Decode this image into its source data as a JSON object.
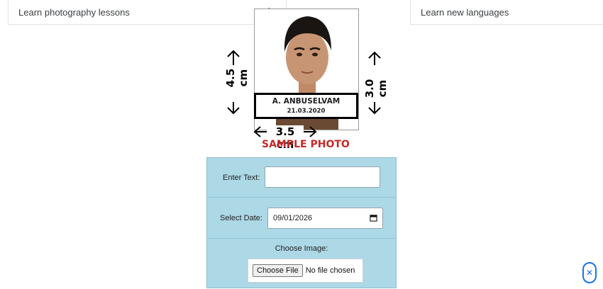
{
  "suggestions": {
    "left_label": "Learn photography lessons",
    "right_label": "Learn new languages"
  },
  "sample": {
    "name": "A. ANBUSELVAM",
    "date": "21.03.2020",
    "height_left": "4.5 cm",
    "height_right": "3.0 cm",
    "width": "3.5 cm",
    "title": "SAMPLE PHOTO",
    "title_color": "#c62828"
  },
  "form": {
    "text_label": "Enter Text:",
    "text_value": "",
    "date_label": "Select Date:",
    "date_value": "09/01/2026",
    "image_label": "Choose Image:",
    "file_button": "Choose File",
    "file_status": "No file chosen",
    "background": "#add8e6"
  },
  "icons": {
    "suggestion_chevron": "chevron-right-icon",
    "date": "calendar-icon",
    "fab": "close-icon"
  }
}
